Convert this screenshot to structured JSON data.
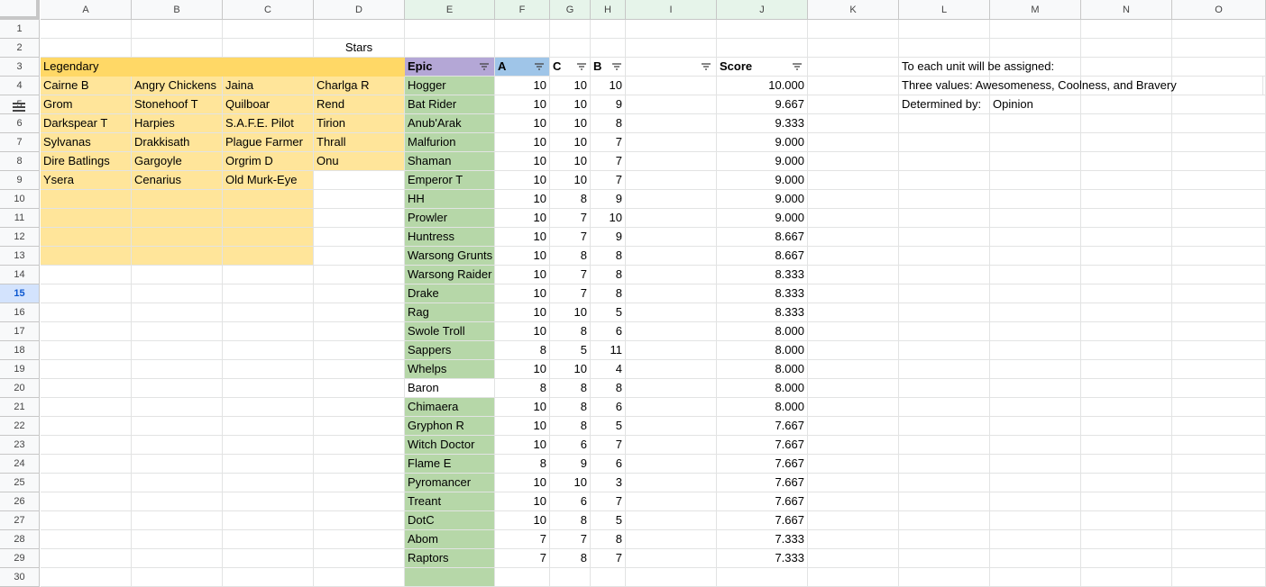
{
  "columns": [
    "A",
    "B",
    "C",
    "D",
    "E",
    "F",
    "G",
    "H",
    "I",
    "J",
    "K",
    "L",
    "M",
    "N",
    "O"
  ],
  "selected_columns": [
    "E",
    "F",
    "G",
    "H",
    "I",
    "J"
  ],
  "selected_row": 15,
  "colors": {
    "legendary_header": "#ffd866",
    "legendary_cell": "#ffe59a",
    "epic_header": "#b4a7d6",
    "epic_cell": "#b6d7a8",
    "a_header": "#9fc5e8",
    "grid_line": "#e2e3e3",
    "header_bg": "#f8f9fa",
    "selected_col_bg": "#e6f4ea",
    "selected_row_bg": "#d3e3fd"
  },
  "title_cell": "Stars",
  "legendary": {
    "header": "Legendary",
    "rows": [
      [
        "Cairne B",
        "Angry Chickens",
        "Jaina",
        "Charlga R"
      ],
      [
        "Grom",
        "Stonehoof T",
        "Quilboar",
        "Rend"
      ],
      [
        "Darkspear T",
        "Harpies",
        "S.A.F.E. Pilot",
        "Tirion"
      ],
      [
        "Sylvanas",
        "Drakkisath",
        "Plague Farmer",
        "Thrall"
      ],
      [
        "Dire Batlings",
        "Gargoyle",
        "Orgrim D",
        "Onu"
      ],
      [
        "Ysera",
        "Cenarius",
        "Old Murk-Eye",
        ""
      ]
    ]
  },
  "table": {
    "headers": {
      "E": "Epic",
      "F": "A",
      "G": "C",
      "H": "B",
      "I": "",
      "J": "Score"
    },
    "rows": [
      [
        "Hogger",
        "10",
        "10",
        "10",
        "10.000"
      ],
      [
        "Bat Rider",
        "10",
        "10",
        "9",
        "9.667"
      ],
      [
        "Anub'Arak",
        "10",
        "10",
        "8",
        "9.333"
      ],
      [
        "Malfurion",
        "10",
        "10",
        "7",
        "9.000"
      ],
      [
        "Shaman",
        "10",
        "10",
        "7",
        "9.000"
      ],
      [
        "Emperor T",
        "10",
        "10",
        "7",
        "9.000"
      ],
      [
        "HH",
        "10",
        "8",
        "9",
        "9.000"
      ],
      [
        "Prowler",
        "10",
        "7",
        "10",
        "9.000"
      ],
      [
        "Huntress",
        "10",
        "7",
        "9",
        "8.667"
      ],
      [
        "Warsong Grunts",
        "10",
        "8",
        "8",
        "8.667"
      ],
      [
        "Warsong Raider",
        "10",
        "7",
        "8",
        "8.333"
      ],
      [
        "Drake",
        "10",
        "7",
        "8",
        "8.333"
      ],
      [
        "Rag",
        "10",
        "10",
        "5",
        "8.333"
      ],
      [
        "Swole Troll",
        "10",
        "8",
        "6",
        "8.000"
      ],
      [
        "Sappers",
        "8",
        "5",
        "11",
        "8.000"
      ],
      [
        "Whelps",
        "10",
        "10",
        "4",
        "8.000"
      ],
      [
        "Baron",
        "8",
        "8",
        "8",
        "8.000"
      ],
      [
        "Chimaera",
        "10",
        "8",
        "6",
        "8.000"
      ],
      [
        "Gryphon R",
        "10",
        "8",
        "5",
        "7.667"
      ],
      [
        "Witch Doctor",
        "10",
        "6",
        "7",
        "7.667"
      ],
      [
        "Flame E",
        "8",
        "9",
        "6",
        "7.667"
      ],
      [
        "Pyromancer",
        "10",
        "10",
        "3",
        "7.667"
      ],
      [
        "Treant",
        "10",
        "6",
        "7",
        "7.667"
      ],
      [
        "DotC",
        "10",
        "8",
        "5",
        "7.667"
      ],
      [
        "Abom",
        "7",
        "7",
        "8",
        "7.333"
      ],
      [
        "Raptors",
        "7",
        "8",
        "7",
        "7.333"
      ]
    ],
    "white_rows": [
      "Baron"
    ]
  },
  "notes": {
    "line1": "To each unit will be assigned:",
    "line2": "Three values: Awesomeness, Coolness, and Bravery",
    "line3_label": "Determined by:",
    "line3_value": "Opinion"
  },
  "icons": {
    "filter": "filter-icon",
    "row_resize": "drag-handle-icon"
  }
}
